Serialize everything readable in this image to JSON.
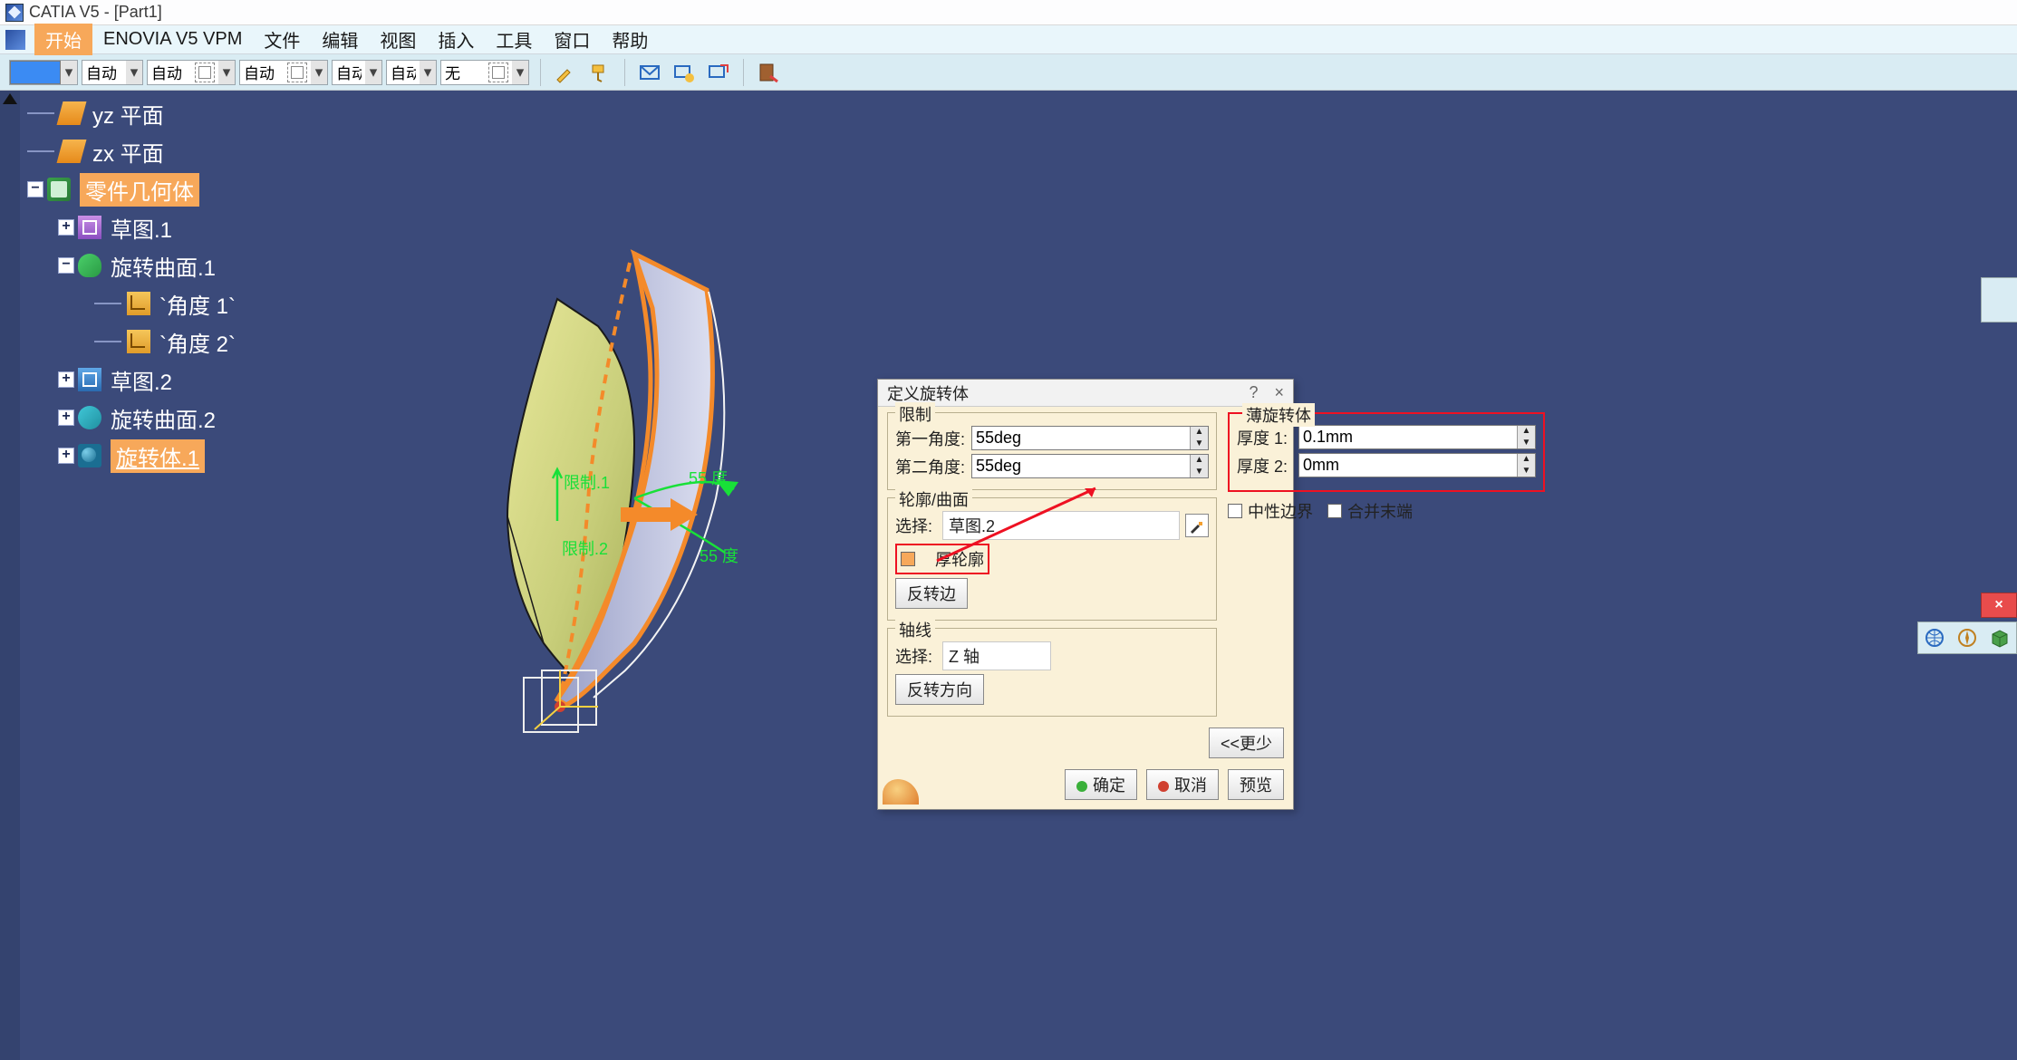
{
  "title": "CATIA V5 - [Part1]",
  "menus": {
    "start": "开始",
    "enovia": "ENOVIA V5 VPM",
    "file": "文件",
    "edit": "编辑",
    "view": "视图",
    "insert": "插入",
    "tools": "工具",
    "window": "窗口",
    "help": "帮助"
  },
  "toolbar": {
    "auto1": "自动",
    "auto2": "自动",
    "auto3": "自动",
    "auto4": "自动",
    "auto5": "自动",
    "none": "无"
  },
  "tree": {
    "yz": "yz 平面",
    "zx": "zx 平面",
    "body": "零件几何体",
    "sketch1": "草图.1",
    "revolSurf1": "旋转曲面.1",
    "angle1": "`角度 1`",
    "angle2": "`角度 2`",
    "sketch2": "草图.2",
    "revolSurf2": "旋转曲面.2",
    "shaft1": "旋转体.1"
  },
  "viewport": {
    "limit1": "限制.1",
    "limit2": "限制.2",
    "deg55a": "55 度",
    "deg55b": "55 度"
  },
  "dialog": {
    "title": "定义旋转体",
    "help": "?",
    "close": "×",
    "limit_grp": "限制",
    "angle1_lbl": "第一角度:",
    "angle1_val": "55deg",
    "angle2_lbl": "第二角度:",
    "angle2_val": "55deg",
    "profile_grp": "轮廓/曲面",
    "select_lbl": "选择:",
    "profile_val": "草图.2",
    "thick_profile": "厚轮廓",
    "reverse_side": "反转边",
    "axis_grp": "轴线",
    "axis_val": "Z 轴",
    "reverse_dir": "反转方向",
    "thin_grp": "薄旋转体",
    "thick1_lbl": "厚度 1:",
    "thick1_val": "0.1mm",
    "thick2_lbl": "厚度 2:",
    "thick2_val": "0mm",
    "neutral": "中性边界",
    "merge": "合并末端",
    "less": "<<更少",
    "ok": "确定",
    "cancel": "取消",
    "preview": "预览"
  },
  "floats": {
    "close_x": "×"
  }
}
